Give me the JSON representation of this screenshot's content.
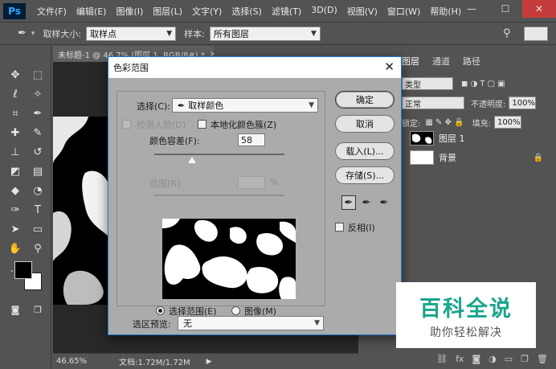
{
  "app": {
    "logo": "Ps"
  },
  "menu": [
    "文件(F)",
    "编辑(E)",
    "图像(I)",
    "图层(L)",
    "文字(Y)",
    "选择(S)",
    "滤镜(T)",
    "3D(D)",
    "视图(V)",
    "窗口(W)",
    "帮助(H)"
  ],
  "window_controls": {
    "minimize": "—",
    "maximize": "☐",
    "close": "✕"
  },
  "options": {
    "sample_size_label": "取样大小:",
    "sample_size_value": "取样点",
    "sample_label": "样本:",
    "sample_value": "所有图层"
  },
  "document": {
    "tab_title": "未标题-1 @ 46.7% (图层 1, RGB/8#) *",
    "tab_close": "×",
    "zoom": "46.65%",
    "doc_info": "文档:1.72M/1.72M"
  },
  "panels": {
    "tabs": [
      "图层",
      "通道",
      "路径"
    ],
    "kind_label": "类型",
    "blend_mode": "正常",
    "opacity_label": "不透明度:",
    "opacity_value": "100%",
    "lock_label": "锁定:",
    "fill_label": "填充:",
    "fill_value": "100%",
    "layers": [
      {
        "name": "图层 1",
        "selected": false
      },
      {
        "name": "背景",
        "locked": true
      }
    ]
  },
  "dialog": {
    "title": "色彩范围",
    "close": "✕",
    "select_label": "选择(C):",
    "select_value": "取样颜色",
    "detect_faces_label": "检测人脸(D)",
    "localized_label": "本地化颜色簇(Z)",
    "fuzziness_label": "颜色容差(F):",
    "fuzziness_value": "58",
    "range_label": "范围(R):",
    "range_unit": "%",
    "radio_selection": "选择范围(E)",
    "radio_image": "图像(M)",
    "preview_label": "选区预览:",
    "preview_value": "无",
    "invert_label": "反相(I)",
    "buttons": {
      "ok": "确定",
      "cancel": "取消",
      "load": "载入(L)...",
      "save": "存储(S)..."
    }
  },
  "watermark": {
    "title": "百科全说",
    "subtitle": "助你轻松解决"
  }
}
